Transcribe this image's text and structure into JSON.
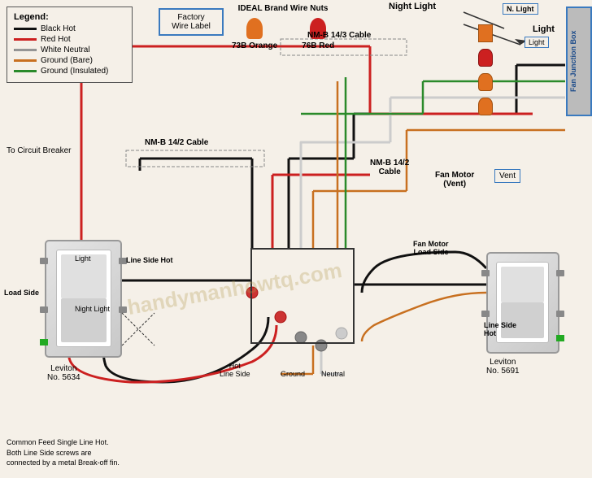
{
  "legend": {
    "title": "Legend:",
    "items": [
      {
        "label": "Black Hot",
        "color": "#111111"
      },
      {
        "label": "Red Hot",
        "color": "#cc2020"
      },
      {
        "label": "White Neutral",
        "color": "#cccccc"
      },
      {
        "label": "Ground (Bare)",
        "color": "#c87020"
      },
      {
        "label": "Ground (Insulated)",
        "color": "#2a8a2a"
      }
    ]
  },
  "factory_label": {
    "line1": "Factory",
    "line2": "Wire Label"
  },
  "wire_nuts": {
    "title": "IDEAL Brand Wire Nuts",
    "items": [
      {
        "id": "73B Orange",
        "color": "#e07020"
      },
      {
        "id": "76B Red",
        "color": "#cc2020"
      }
    ]
  },
  "labels": {
    "night_light_top": "Night Light",
    "light_top": "Light",
    "n_light": "N. Light",
    "light_box": "Light",
    "fan_junction": "Fan Junction Box",
    "vent": "Vent",
    "nmb_142_left": "NM-B 14/2 Cable",
    "nmb_143": "NM-B 14/3 Cable",
    "nmb_142_right": "NM-B 14/2\nCable",
    "fan_motor_vent": "Fan Motor\n(Vent)",
    "circuit_breaker": "To Circuit Breaker",
    "light_switch_left": "Light",
    "night_light_switch": "Night Light",
    "load_side_left": "Load Side",
    "line_side_hot_left": "Line Side Hot",
    "fan_motor_load_side": "Fan Motor\nLoad Side",
    "line_side_hot_right": "Line Side\nHot",
    "leviton_left": "Leviton\nNo. 5634",
    "leviton_right": "Leviton\nNo. 5691",
    "hot_line_side": "Hot\nLine Side",
    "ground": "Ground",
    "neutral": "Neutral",
    "common_feed": "Common Feed Single Line Hot.\nBoth Line Side screws are\nconnected by a metal Break-off fin.",
    "watermark": "handymanhowtq.com"
  }
}
